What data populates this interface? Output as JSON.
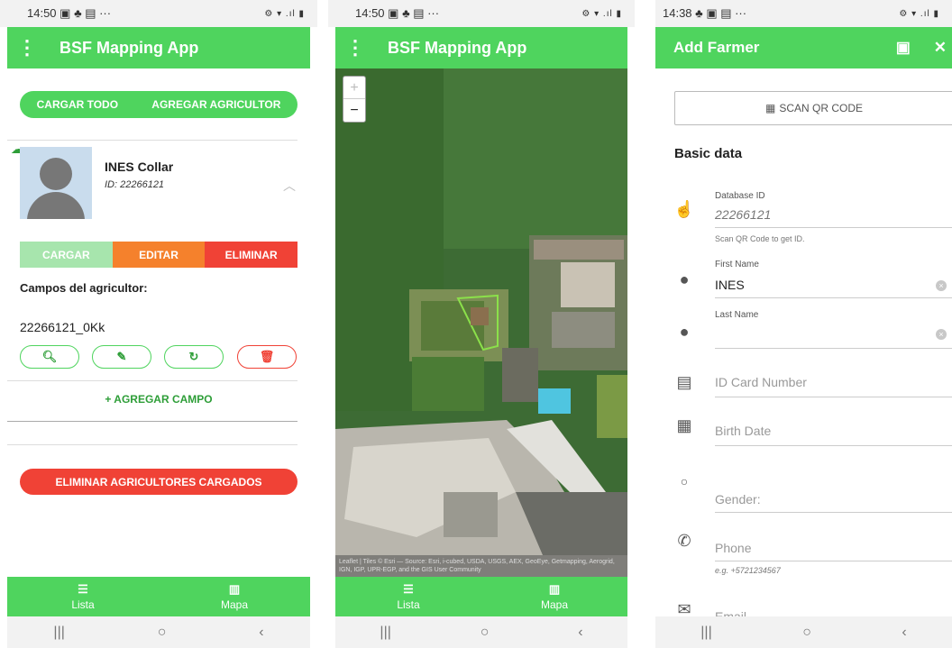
{
  "panel1": {
    "status": {
      "time": "14:50",
      "left_icons": "▣ ♣ ▤ ···",
      "right_icons": "⚙ ▾ .ıl ▮"
    },
    "appbar": {
      "title": "BSF Mapping App",
      "menu_icon": "⋮"
    },
    "top_buttons": {
      "cargar_todo": "CARGAR TODO",
      "agregar": "AGREGAR AGRICULTOR"
    },
    "farmer": {
      "name": "INES Collar",
      "id_text": "ID: 22266121"
    },
    "actions": {
      "cargar": "CARGAR",
      "editar": "EDITAR",
      "eliminar": "ELIMINAR"
    },
    "campos_title": "Campos del agricultor:",
    "field_id": "22266121_0Kk",
    "field_icons": [
      "search-icon",
      "pencil-icon",
      "refresh-icon",
      "trash-icon"
    ],
    "add_field": "+ AGREGAR CAMPO",
    "delete_all": "ELIMINAR AGRICULTORES CARGADOS",
    "nav": [
      {
        "label": "Lista",
        "icon": "list-icon"
      },
      {
        "label": "Mapa",
        "icon": "map-icon"
      }
    ]
  },
  "panel2": {
    "status": {
      "time": "14:50",
      "left_icons": "▣ ♣ ▤ ···",
      "right_icons": "⚙ ▾ .ıl ▮"
    },
    "appbar": {
      "title": "BSF Mapping App",
      "menu_icon": "⋮"
    },
    "zoom": {
      "in": "+",
      "out": "−"
    },
    "attribution": "Leaflet | Tiles © Esri — Source: Esri, i-cubed, USDA, USGS, AEX, GeoEye, Getmapping, Aerogrid, IGN, IGP, UPR-EGP, and the GIS User Community",
    "nav": [
      {
        "label": "Lista",
        "icon": "list-icon"
      },
      {
        "label": "Mapa",
        "icon": "map-icon"
      }
    ]
  },
  "panel3": {
    "status": {
      "time": "14:38",
      "left_icons": "♣ ▣ ▤ ···",
      "right_icons": "⚙ ▾ .ıl ▮"
    },
    "appbar": {
      "title": "Add Farmer",
      "save_icon": "save-icon",
      "close_icon": "close-icon"
    },
    "scan_button": "SCAN QR CODE",
    "section": "Basic data",
    "fields": {
      "database_id": {
        "label": "Database ID",
        "value": "22266121",
        "hint": "Scan QR Code to get ID."
      },
      "first_name": {
        "label": "First Name",
        "value": "INES"
      },
      "last_name": {
        "label": "Last Name",
        "value": ""
      },
      "id_card": {
        "placeholder": "ID Card Number"
      },
      "birth_date": {
        "placeholder": "Birth Date"
      },
      "gender": {
        "placeholder": "Gender:"
      },
      "phone": {
        "placeholder": "Phone",
        "hint": "e.g. +5721234567"
      },
      "email": {
        "placeholder": "Email"
      }
    }
  },
  "colors": {
    "accent": "#4fd45e",
    "orange": "#f5812c",
    "red": "#f04236",
    "light_green": "#a7e5ad"
  }
}
